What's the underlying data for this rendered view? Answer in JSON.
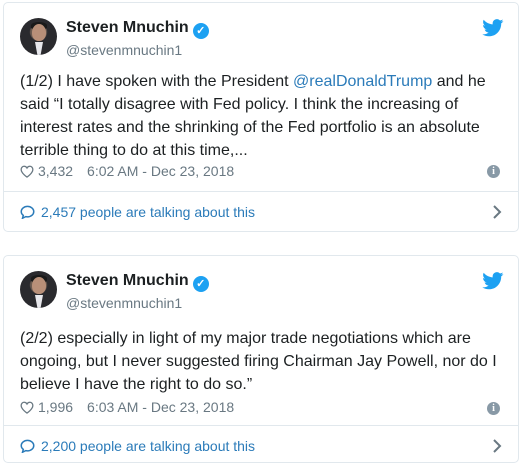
{
  "tweets": [
    {
      "author_name": "Steven Mnuchin",
      "verified_mark": "✓",
      "handle": "@stevenmnuchin1",
      "text_before": "(1/2) I have spoken with the President ",
      "mention": "@realDonaldTrump",
      "text_after": " and he said “I totally disagree with Fed policy. I think the increasing of interest rates and the shrinking of the Fed portfolio is an absolute terrible thing to do at this time,...",
      "likes": "3,432",
      "timestamp": "6:02 AM - Dec 23, 2018",
      "info_mark": "i",
      "talking": "2,457 people are talking about this"
    },
    {
      "author_name": "Steven Mnuchin",
      "verified_mark": "✓",
      "handle": "@stevenmnuchin1",
      "text_before": "(2/2) especially in light of my major trade negotiations which are ongoing, but I never suggested firing Chairman Jay Powell, nor do I believe I have the right to do so.”",
      "mention": "",
      "text_after": "",
      "likes": "1,996",
      "timestamp": "6:03 AM - Dec 23, 2018",
      "info_mark": "i",
      "talking": "2,200 people are talking about this"
    }
  ],
  "icons": {
    "brand": "twitter-bird-icon",
    "like": "heart-icon",
    "info": "info-icon",
    "reply": "speech-bubble-icon",
    "more": "chevron-right-icon"
  },
  "colors": {
    "twitter_blue": "#1da1f2",
    "link_blue": "#2b7bb9",
    "muted_gray": "#697882",
    "border": "#e1e8ed",
    "text": "#1c2022"
  }
}
